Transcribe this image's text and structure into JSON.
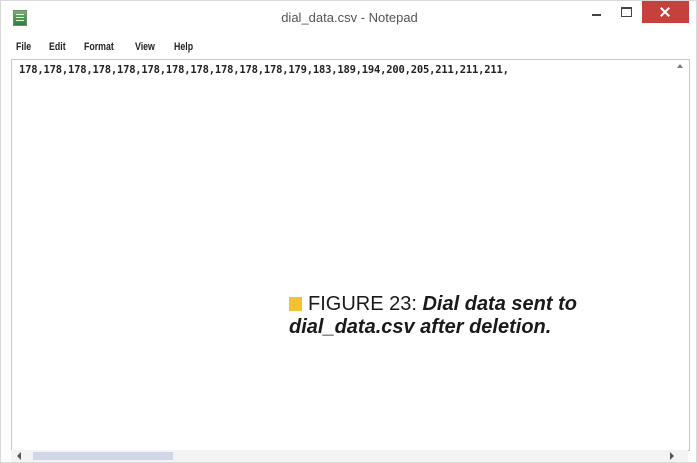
{
  "window": {
    "title": "dial_data.csv - Notepad"
  },
  "menu": {
    "file": "File",
    "edit": "Edit",
    "format": "Format",
    "view": "View",
    "help": "Help"
  },
  "editor": {
    "content": "178,178,178,178,178,178,178,178,178,178,178,179,183,189,194,200,205,211,211,211,"
  },
  "caption": {
    "label": "FIGURE 23:",
    "text": "Dial data sent to dial_data.csv after deletion."
  },
  "colors": {
    "close_button": "#c7413c",
    "caption_marker": "#f2c230"
  },
  "icons": {
    "app": "notepad-icon",
    "minimize": "minimize-icon",
    "maximize": "maximize-icon",
    "close": "close-icon"
  }
}
